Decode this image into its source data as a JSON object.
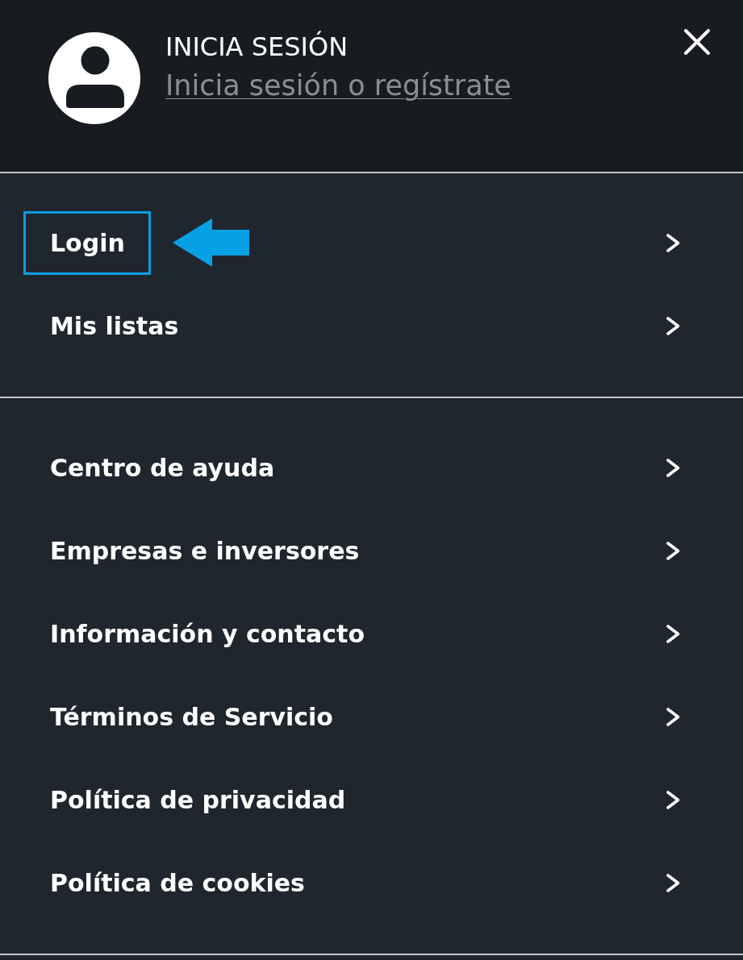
{
  "header": {
    "title": "INICIA SESIÓN",
    "link": "Inicia sesión o regístrate"
  },
  "menu_sections": [
    {
      "items": [
        {
          "label": "Login",
          "highlighted": true
        },
        {
          "label": "Mis listas",
          "highlighted": false
        }
      ]
    },
    {
      "items": [
        {
          "label": "Centro de ayuda",
          "highlighted": false
        },
        {
          "label": "Empresas e inversores",
          "highlighted": false
        },
        {
          "label": "Información y contacto",
          "highlighted": false
        },
        {
          "label": "Términos de Servicio",
          "highlighted": false
        },
        {
          "label": "Política de privacidad",
          "highlighted": false
        },
        {
          "label": "Política de cookies",
          "highlighted": false
        }
      ]
    }
  ]
}
